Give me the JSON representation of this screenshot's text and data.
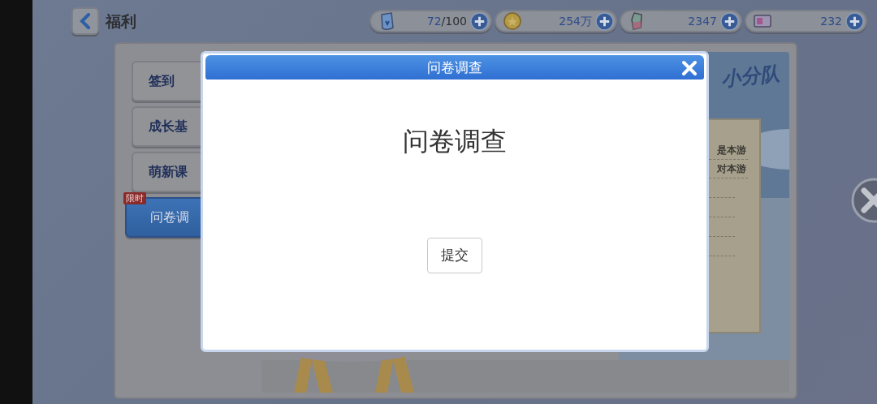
{
  "header": {
    "title": "福利"
  },
  "resources": [
    {
      "kind": "stamina",
      "current": "72",
      "total": "/100"
    },
    {
      "kind": "coin",
      "current": "254万"
    },
    {
      "kind": "crystal",
      "current": "2347"
    },
    {
      "kind": "ticket",
      "current": "232"
    }
  ],
  "tabs": [
    {
      "label": "签到",
      "selected": false
    },
    {
      "label": "成长基",
      "selected": false
    },
    {
      "label": "萌新课",
      "selected": false
    },
    {
      "label": "问卷调",
      "selected": true,
      "badge": "限时"
    }
  ],
  "content": {
    "logo": "小分队",
    "lines": [
      "是本游",
      "对本游"
    ]
  },
  "dialog": {
    "title": "问卷调查",
    "heading": "问卷调查",
    "submit": "提交"
  }
}
